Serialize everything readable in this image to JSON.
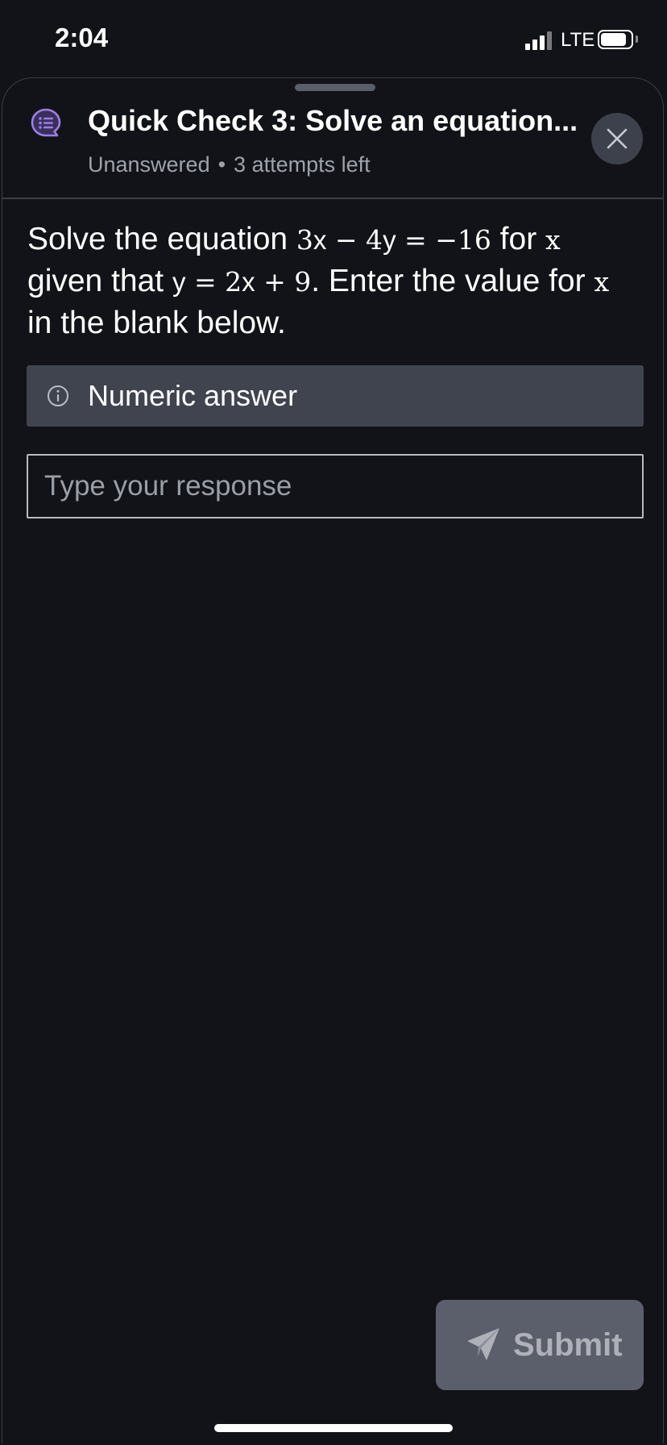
{
  "status_bar": {
    "time": "2:04",
    "network": "LTE",
    "signal_bars_active": 3,
    "battery_level": 0.85
  },
  "header": {
    "title": "Quick Check 3: Solve an equation...",
    "status": "Unanswered",
    "separator": "•",
    "attempts": "3 attempts left"
  },
  "question": {
    "text_1": "Solve the equation ",
    "eq1_a": "3",
    "eq1_var1": "x",
    "eq1_op1": " − 4",
    "eq1_var2": "y",
    "eq1_rest": " = −16",
    "text_2": " for ",
    "var_x1": "x",
    "text_3": " given that ",
    "eq2_var1": "y",
    "eq2_mid": " = 2",
    "eq2_var2": "x",
    "eq2_rest": " + 9",
    "text_4": ". Enter the value for ",
    "var_x2": "x",
    "text_5": " in the blank below."
  },
  "answer_type": {
    "label": "Numeric answer"
  },
  "response": {
    "placeholder": "Type your response",
    "value": ""
  },
  "submit": {
    "label": "Submit"
  },
  "colors": {
    "background": "#121318",
    "accent_icon": "#9b7fe0",
    "banner": "#40444f",
    "button_disabled": "#5b5f6b"
  },
  "icons": {
    "header": "chat-list-icon",
    "close": "close-icon",
    "info": "info-icon",
    "submit": "send-icon"
  }
}
